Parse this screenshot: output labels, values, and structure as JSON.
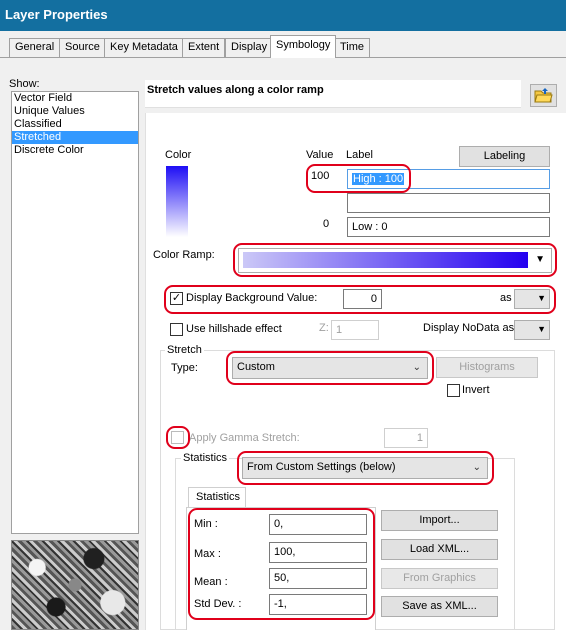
{
  "window": {
    "title": "Layer Properties"
  },
  "tabs": [
    "General",
    "Source",
    "Key Metadata",
    "Extent",
    "Display",
    "Symbology",
    "Time"
  ],
  "show_panel": {
    "label": "Show:",
    "items": [
      "Vector Field",
      "Unique Values",
      "Classified",
      "Stretched",
      "Discrete Color"
    ],
    "selected": "Stretched"
  },
  "header": {
    "title": "Stretch values along a color ramp"
  },
  "legend": {
    "color_label": "Color",
    "value_label": "Value",
    "label_label": "Label",
    "labeling_button": "Labeling",
    "high_value": "100",
    "high_label": "High : 100",
    "mid_value": "",
    "mid_label": "",
    "low_value": "0",
    "low_label": "Low : 0"
  },
  "color_ramp": {
    "label": "Color Ramp:"
  },
  "background": {
    "label": "Display Background Value:",
    "value": "0",
    "as_label": "as",
    "checked": true
  },
  "hillshade": {
    "label": "Use hillshade effect",
    "z_label": "Z:",
    "z_value": "1",
    "checked": false
  },
  "nodata": {
    "label": "Display NoData as"
  },
  "stretch": {
    "group_label": "Stretch",
    "type_label": "Type:",
    "type_value": "Custom",
    "histograms_button": "Histograms",
    "invert_label": "Invert",
    "gamma_label": "Apply Gamma Stretch:",
    "gamma_value": "1"
  },
  "statistics": {
    "group_label": "Statistics",
    "source_value": "From Custom Settings (below)",
    "tab_label": "Statistics",
    "min_label": "Min :",
    "min_value": "0,",
    "max_label": "Max :",
    "max_value": "100,",
    "mean_label": "Mean :",
    "mean_value": "50,",
    "std_label": "Std Dev. :",
    "std_value": "-1,",
    "import_button": "Import...",
    "load_xml_button": "Load XML...",
    "from_graphics_button": "From Graphics",
    "save_xml_button": "Save as XML..."
  },
  "colors": {
    "titlebar": "#136fa0",
    "highlight": "#e0001b",
    "ramp_start": "#cbc8f7",
    "ramp_end": "#2400f0",
    "selection": "#3399ff"
  }
}
